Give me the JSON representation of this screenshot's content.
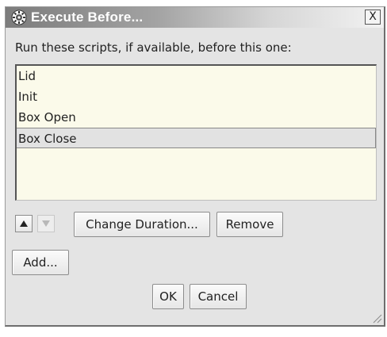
{
  "window": {
    "title": "Execute Before...",
    "close_label": "X",
    "title_icon": "gear-icon"
  },
  "prompt": "Run these scripts, if available, before this one:",
  "scripts": [
    {
      "label": "Lid",
      "selected": false
    },
    {
      "label": "Init",
      "selected": false
    },
    {
      "label": "Box Open",
      "selected": false
    },
    {
      "label": "Box Close",
      "selected": true
    }
  ],
  "toolbar": {
    "move_up_icon": "triangle-up-icon",
    "move_down_icon": "triangle-down-icon",
    "move_down_enabled": false,
    "change_duration_label": "Change Duration...",
    "remove_label": "Remove",
    "add_label": "Add..."
  },
  "dialog_buttons": {
    "ok_label": "OK",
    "cancel_label": "Cancel"
  },
  "colors": {
    "list_background": "#fbfaea",
    "selected_row": "#e2e2e2",
    "window_background": "#e4e4e4"
  }
}
